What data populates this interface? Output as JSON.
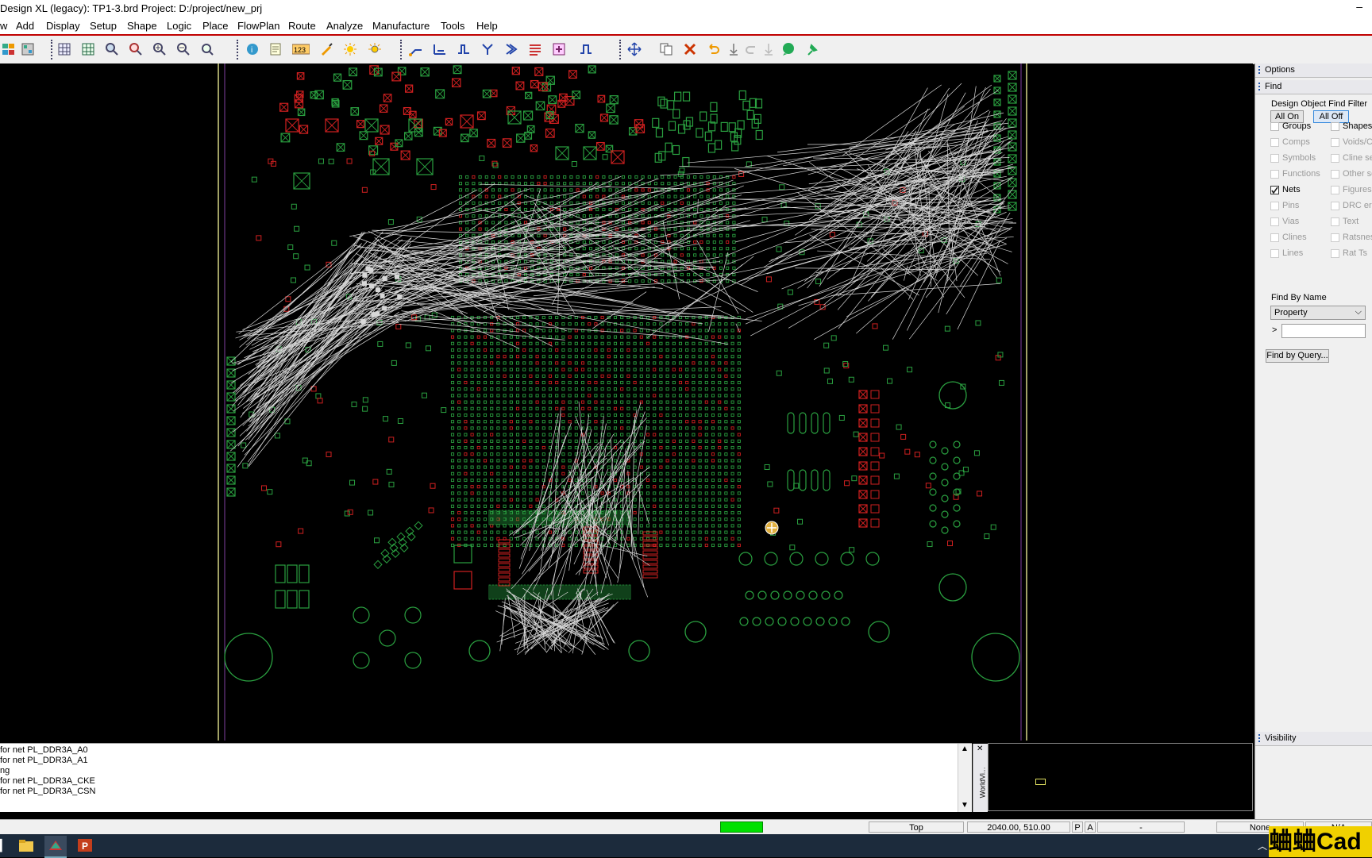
{
  "window": {
    "title": "Design XL (legacy): TP1-3.brd  Project: D:/project/new_prj",
    "minimize": "–"
  },
  "menu": {
    "items": [
      "w",
      "Add",
      "Display",
      "Setup",
      "Shape",
      "Logic",
      "Place",
      "FlowPlan",
      "Route",
      "Analyze",
      "Manufacture",
      "Tools",
      "Help"
    ]
  },
  "toolbar": {
    "icons": [
      "layers-icon",
      "color-icon",
      "grid-icon",
      "grid2-icon",
      "zoom-fit-icon",
      "zoom-window-icon",
      "zoom-in-icon",
      "zoom-out-icon",
      "zoom-prev-icon",
      "info-icon",
      "properties-icon",
      "numbers-icon",
      "brush-icon",
      "sun-icon",
      "sun2-icon",
      "route-icon",
      "slide-icon",
      "delay-icon",
      "fanout-icon",
      "bus-icon",
      "spread-icon",
      "diff-icon",
      "gloss-icon",
      "move-icon",
      "copy-icon",
      "delete-icon",
      "undo-icon",
      "down-icon",
      "redo-icon",
      "redo-down-icon",
      "bubble-icon",
      "pin-icon"
    ]
  },
  "panel": {
    "options_label": "Options",
    "find_label": "Find",
    "filter_title": "Design Object Find Filter",
    "all_on": "All On",
    "all_off": "All Off",
    "checks": [
      {
        "label": "Groups",
        "on": false,
        "enabled": true
      },
      {
        "label": "Shapes",
        "on": false,
        "enabled": true
      },
      {
        "label": "Comps",
        "on": false,
        "enabled": false
      },
      {
        "label": "Voids/Cavities",
        "on": false,
        "enabled": false
      },
      {
        "label": "Symbols",
        "on": false,
        "enabled": false
      },
      {
        "label": "Cline segs",
        "on": false,
        "enabled": false
      },
      {
        "label": "Functions",
        "on": false,
        "enabled": false
      },
      {
        "label": "Other segs",
        "on": false,
        "enabled": false
      },
      {
        "label": "Nets",
        "on": true,
        "enabled": true
      },
      {
        "label": "Figures",
        "on": false,
        "enabled": false
      },
      {
        "label": "Pins",
        "on": false,
        "enabled": false
      },
      {
        "label": "DRC errors",
        "on": false,
        "enabled": false
      },
      {
        "label": "Vias",
        "on": false,
        "enabled": false
      },
      {
        "label": "Text",
        "on": false,
        "enabled": false
      },
      {
        "label": "Clines",
        "on": false,
        "enabled": false
      },
      {
        "label": "Ratsnests",
        "on": false,
        "enabled": false
      },
      {
        "label": "Lines",
        "on": false,
        "enabled": false
      },
      {
        "label": "Rat Ts",
        "on": false,
        "enabled": false
      }
    ],
    "find_by_name": "Find By Name",
    "property": "Property",
    "arrow": ">",
    "name_value": "",
    "find_by_query": "Find by Query...",
    "visibility_label": "Visibility"
  },
  "log": {
    "lines": [
      " for net PL_DDR3A_A0",
      " for net PL_DDR3A_A1",
      "ng",
      " for net PL_DDR3A_CKE",
      " for net PL_DDR3A_CSN"
    ]
  },
  "worldview": {
    "label": "WorldVi..."
  },
  "status": {
    "layer": "Top",
    "coords": "2040.00, 510.00",
    "p": "P",
    "a": "A",
    "dash": "-",
    "mode": "None",
    "na": "N/A",
    "active_color": "#00e000"
  },
  "watermark": {
    "text": "蛐蛐Cad"
  },
  "colors": {
    "board_outline": "#d8d888",
    "route_keepin": "#8040a0",
    "pad_green": "#2aa040",
    "pad_red": "#d02020",
    "ratsnest": "#d8d8d8"
  }
}
